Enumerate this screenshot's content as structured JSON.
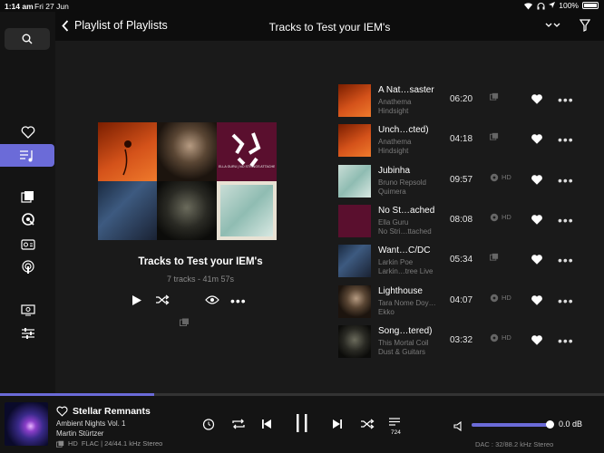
{
  "status": {
    "time": "1:14 am",
    "date": "Fri 27 Jun",
    "battery": "100%"
  },
  "header": {
    "back_label": "Playlist of Playlists",
    "title": "Tracks to Test your IEM's"
  },
  "playlist": {
    "title": "Tracks to Test your IEM's",
    "subtitle": "7 tracks - 41m 57s",
    "mosaic_caption": "ELLA GURU | NO STRINGS ATTACHED EP"
  },
  "tracks": [
    {
      "title": "A Nat…saster",
      "artist": "Anathema",
      "album": "Hindsight",
      "duration": "06:20",
      "quality": "",
      "art": "orange"
    },
    {
      "title": "Unch…cted)",
      "artist": "Anathema",
      "album": "Hindsight",
      "duration": "04:18",
      "quality": "",
      "art": "orange"
    },
    {
      "title": "Jubinha",
      "artist": "Bruno Repsold",
      "album": "Quimera",
      "duration": "09:57",
      "quality": "HD",
      "art": "teal"
    },
    {
      "title": "No St…ached",
      "artist": "Ella Guru",
      "album": "No Stri…ttached",
      "duration": "08:08",
      "quality": "HD",
      "art": "purple"
    },
    {
      "title": "Want…C/DC",
      "artist": "Larkin Poe",
      "album": "Larkin…tree Live",
      "duration": "05:34",
      "quality": "",
      "art": "blue"
    },
    {
      "title": "Lighthouse",
      "artist": "Tara Nome Doy…",
      "album": "Ekko",
      "duration": "04:07",
      "quality": "HD",
      "art": "brown"
    },
    {
      "title": "Song…tered)",
      "artist": "This Mortal Coil",
      "album": "Dust & Guitars",
      "duration": "03:32",
      "quality": "HD",
      "art": "dark"
    }
  ],
  "player": {
    "title": "Stellar Remnants",
    "album": "Ambient Nights Vol. 1",
    "artist": "Martin Stürtzer",
    "format": "FLAC | 24/44.1 kHz Stereo",
    "hd": "HD",
    "queue_count": "724",
    "volume": "0.0 dB",
    "volume_fraction": 0.96,
    "progress_fraction": 0.255,
    "dac": "DAC : 32/88.2 kHz Stereo"
  },
  "colors": {
    "accent": "#6b6bd8"
  }
}
